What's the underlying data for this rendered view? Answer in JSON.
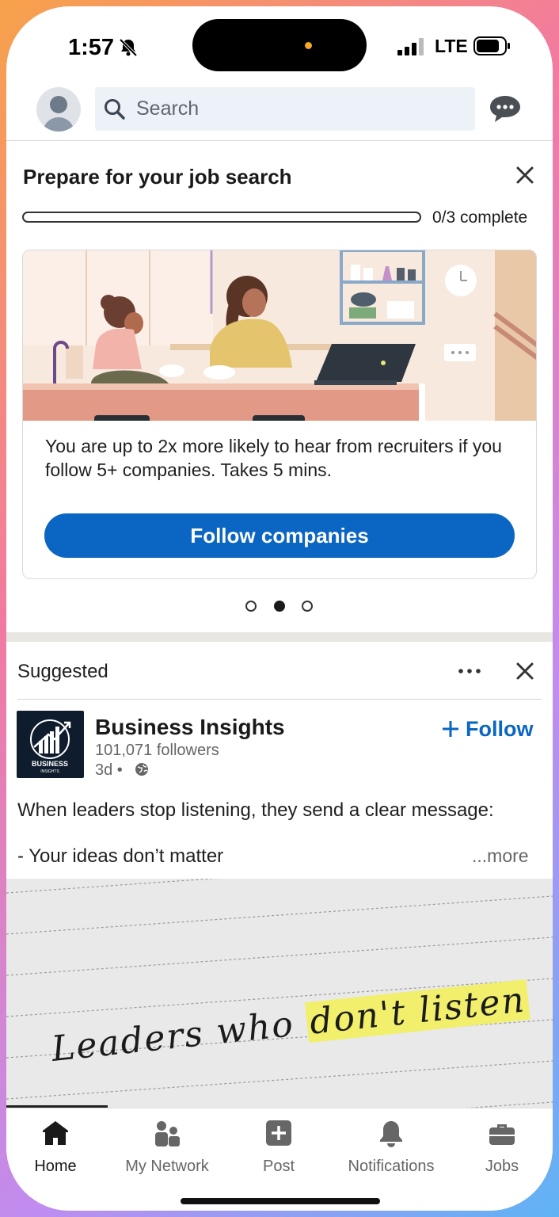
{
  "status_bar": {
    "time": "1:57",
    "network": "LTE"
  },
  "header": {
    "search_placeholder": "Search"
  },
  "job_card": {
    "title": "Prepare for your job search",
    "progress_text": "0/3 complete",
    "progress_fraction": 0,
    "body": "You are up to 2x more likely to hear from recruiters if you follow 5+ companies. Takes 5 mins.",
    "button": "Follow companies",
    "carousel_active_index": 1,
    "carousel_count": 3
  },
  "suggested": {
    "label": "Suggested",
    "company": {
      "name": "Business Insights",
      "followers": "101,071 followers",
      "age": "3d •",
      "logo_text_1": "BUSINESS",
      "logo_text_2": "INSIGHTS"
    },
    "follow_label": "Follow",
    "post_line_1": "When leaders stop listening, they send a clear message:",
    "post_line_2": "- Your ideas don’t matter",
    "see_more": "...more",
    "image_text_plain": "Leaders who ",
    "image_text_highlight": "don't listen"
  },
  "tabbar": {
    "tabs": [
      {
        "label": "Home",
        "icon": "home-icon",
        "active": true
      },
      {
        "label": "My Network",
        "icon": "network-icon",
        "active": false
      },
      {
        "label": "Post",
        "icon": "post-icon",
        "active": false
      },
      {
        "label": "Notifications",
        "icon": "bell-icon",
        "active": false
      },
      {
        "label": "Jobs",
        "icon": "briefcase-icon",
        "active": false
      }
    ]
  },
  "colors": {
    "brand_blue": "#0a66c2",
    "highlight": "#f1ef6b"
  }
}
